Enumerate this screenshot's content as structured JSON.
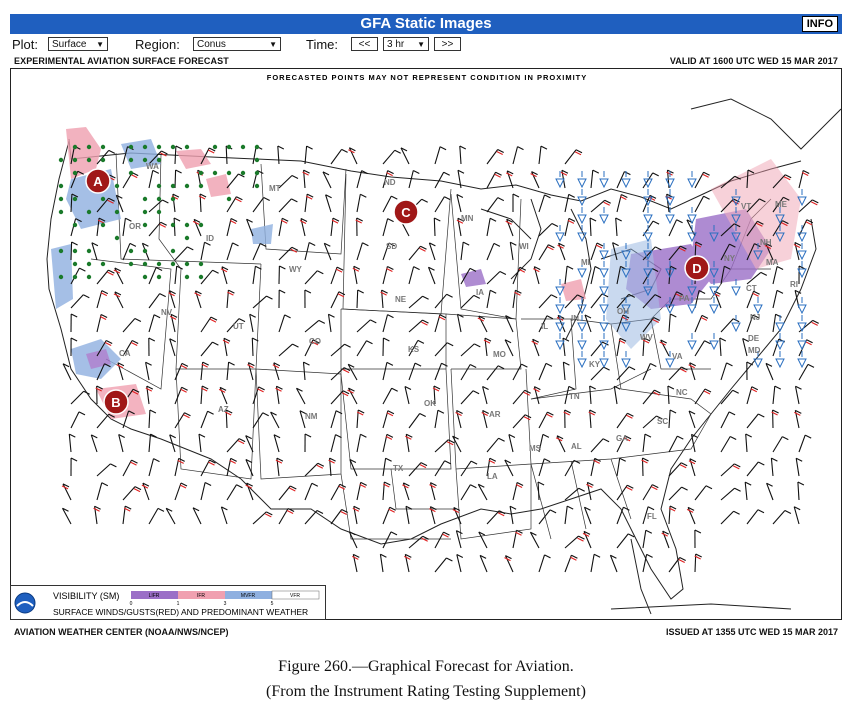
{
  "window": {
    "title": "GFA Static Images",
    "info_button": "INFO"
  },
  "controls": {
    "plot_label": "Plot:",
    "plot_value": "Surface",
    "region_label": "Region:",
    "region_value": "Conus",
    "time_label": "Time:",
    "prev_button": "<<",
    "time_value": "3 hr",
    "next_button": ">>"
  },
  "header": {
    "left": "EXPERIMENTAL AVIATION SURFACE FORECAST",
    "right": "VALID AT 1600 UTC WED 15 MAR 2017"
  },
  "map": {
    "disclaimer": "FORECASTED POINTS MAY NOT REPRESENT CONDITION IN PROXIMITY",
    "state_labels": [
      "WA",
      "MT",
      "ND",
      "MN",
      "OR",
      "ID",
      "SD",
      "WI",
      "MI",
      "WY",
      "NE",
      "IA",
      "NV",
      "UT",
      "CO",
      "KS",
      "MO",
      "IL",
      "IN",
      "OH",
      "NY",
      "PA",
      "VT",
      "NH",
      "ME",
      "MA",
      "RI",
      "CT",
      "NJ",
      "DE",
      "MD",
      "VA",
      "WV",
      "KY",
      "CA",
      "AZ",
      "NM",
      "OK",
      "AR",
      "TN",
      "NC",
      "SC",
      "GA",
      "AL",
      "MS",
      "LA",
      "TX",
      "FL"
    ],
    "markers": [
      "A",
      "B",
      "C",
      "D"
    ],
    "colors": {
      "lifr": "#9b6fc7",
      "ifr": "#f0a0b0",
      "mvfr": "#8fb0e0",
      "vfr": "#ffffff",
      "marker": "#a01818",
      "title_bar": "#1f5fbf",
      "wind_gust": "#e02020"
    }
  },
  "legend": {
    "visibility_label": "VISIBILITY (SM)",
    "categories": [
      "LIFR",
      "IFR",
      "MVFR",
      "VFR"
    ],
    "ticks": [
      "0",
      "1",
      "3",
      "5"
    ],
    "winds_label": "SURFACE WINDS/GUSTS(RED) AND PREDOMINANT WEATHER",
    "logo_icon": "noaa-logo-icon"
  },
  "footer": {
    "left": "AVIATION WEATHER CENTER (NOAA/NWS/NCEP)",
    "right": "ISSUED AT 1355 UTC WED 15 MAR 2017"
  },
  "caption": {
    "line1": "Figure 260.—Graphical Forecast for Aviation.",
    "line2": "(From the Instrument Rating Testing Supplement)"
  }
}
